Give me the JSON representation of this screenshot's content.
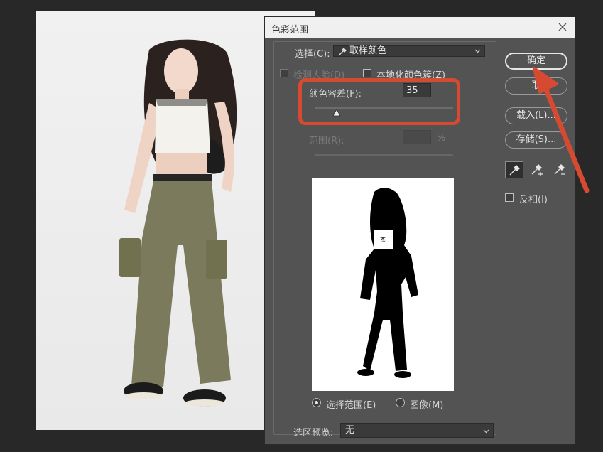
{
  "dialog": {
    "title": "色彩范围",
    "select_label": "选择(C):",
    "select_value": "取样颜色",
    "detect_faces_label": "检测人脸(D)",
    "localized_clusters_label": "本地化颜色簇(Z)",
    "fuzziness_label": "颜色容差(F):",
    "fuzziness_value": "35",
    "fuzziness_level": 0.16,
    "range_label": "范围(R):",
    "range_unit": "%",
    "preview_radio_selection": "选择范围(E)",
    "preview_radio_image": "图像(M)",
    "selection_preview_label": "选区预览:",
    "selection_preview_value": "无"
  },
  "buttons": {
    "ok": "确定",
    "cancel": "取",
    "load": "载入(L)...",
    "save": "存储(S)..."
  },
  "tools": {
    "eyedropper": "eyedropper-icon",
    "eyedropper_add": "eyedropper-plus-icon",
    "eyedropper_subtract": "eyedropper-minus-icon"
  },
  "invert_label": "反相(I)",
  "colors": {
    "dialog_bg": "#535353",
    "highlight": "#d64a32"
  }
}
